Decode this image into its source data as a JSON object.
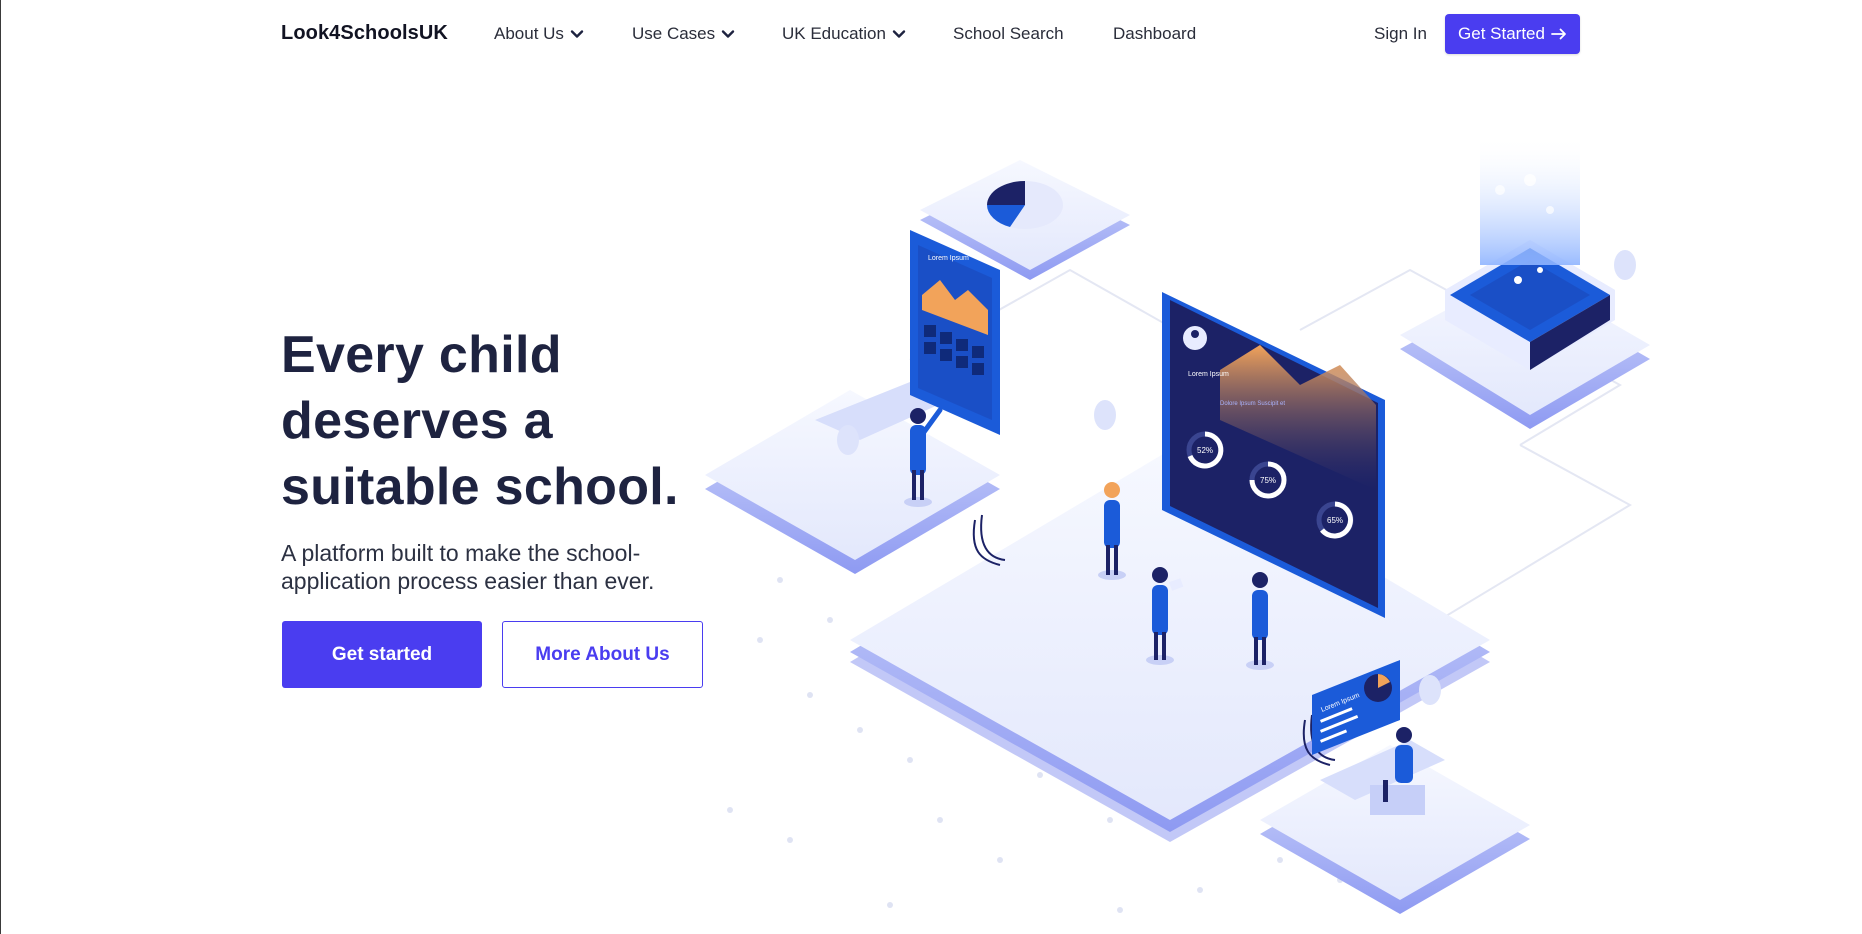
{
  "nav": {
    "brand": "Look4SchoolsUK",
    "items": [
      {
        "label": "About Us",
        "dropdown": true
      },
      {
        "label": "Use Cases",
        "dropdown": true
      },
      {
        "label": "UK Education",
        "dropdown": true
      },
      {
        "label": "School Search",
        "dropdown": false
      },
      {
        "label": "Dashboard",
        "dropdown": false
      }
    ],
    "sign_in": "Sign In",
    "get_started": "Get Started",
    "get_started_icon": "arrow-right-icon"
  },
  "hero": {
    "headline_lines": [
      "Every child",
      "deserves a",
      "suitable school."
    ],
    "subhead": "A platform built to make the school-application process easier than ever.",
    "primary_button": "Get started",
    "secondary_button": "More About Us"
  },
  "illustration": {
    "gauges": [
      "52%",
      "75%",
      "65%"
    ],
    "placeholder_text": "Lorem Ipsum",
    "chart_title": "Dolore Ipsum Suscipit et"
  },
  "colors": {
    "accent": "#4a3df0",
    "heading": "#1e2340",
    "platform": "#eef1fd",
    "screen_dark": "#1c2266",
    "screen_blue": "#1b5bd9",
    "chart_orange": "#f2a35a"
  }
}
